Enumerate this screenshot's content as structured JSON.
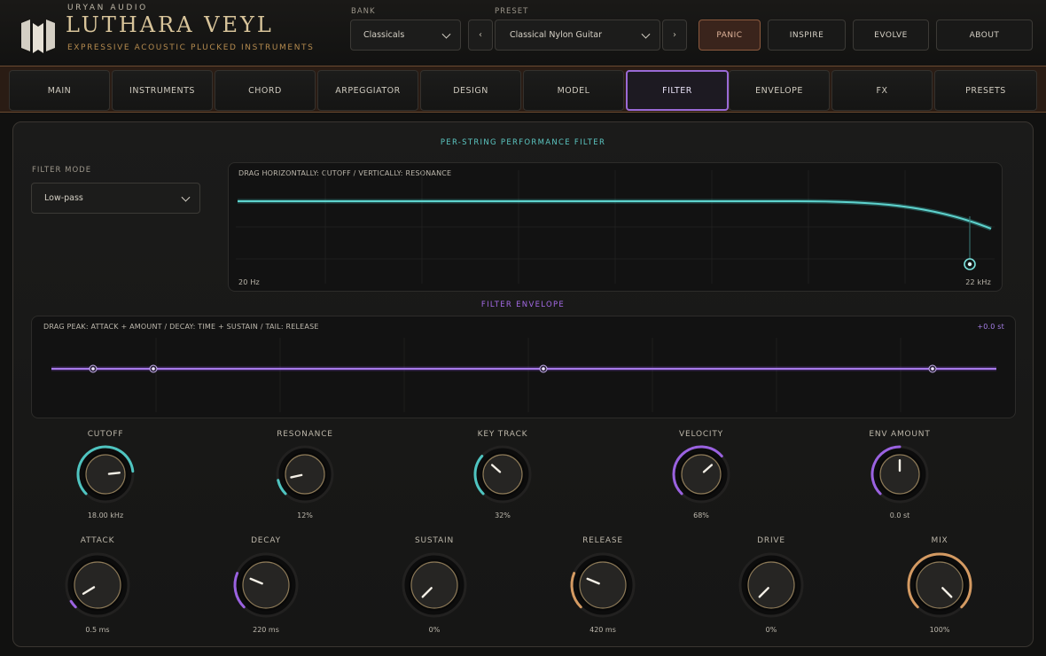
{
  "header": {
    "company": "URYAN AUDIO",
    "title": "LUTHARA VEYL",
    "subtitle": "EXPRESSIVE ACOUSTIC PLUCKED INSTRUMENTS",
    "bank_label": "BANK",
    "bank_value": "Classicals",
    "preset_label": "PRESET",
    "preset_value": "Classical Nylon Guitar",
    "prev_glyph": "‹",
    "next_glyph": "›",
    "buttons": {
      "panic": "PANIC",
      "inspire": "INSPIRE",
      "evolve": "EVOLVE",
      "about": "ABOUT"
    }
  },
  "tabs": [
    "MAIN",
    "INSTRUMENTS",
    "CHORD",
    "ARPEGGIATOR",
    "DESIGN",
    "MODEL",
    "FILTER",
    "ENVELOPE",
    "FX",
    "PRESETS"
  ],
  "active_tab": "FILTER",
  "filter": {
    "section_title": "PER-STRING PERFORMANCE FILTER",
    "mode_label": "FILTER MODE",
    "mode_value": "Low-pass",
    "graph_hint": "DRAG HORIZONTALLY: CUTOFF  /  VERTICALLY: RESONANCE",
    "freq_min": "20 Hz",
    "freq_max": "22 kHz"
  },
  "envelope": {
    "section_title": "FILTER ENVELOPE",
    "hint": "DRAG PEAK: ATTACK + AMOUNT  /  DECAY: TIME + SUSTAIN  /  TAIL: RELEASE",
    "amount_readout": "+0.0 st"
  },
  "knobs_row1": [
    {
      "label": "CUTOFF",
      "value": "18.00 kHz",
      "level": 0.81,
      "color": "#4fc4c0"
    },
    {
      "label": "RESONANCE",
      "value": "12%",
      "level": 0.12,
      "color": "#4fc4c0"
    },
    {
      "label": "KEY TRACK",
      "value": "32%",
      "level": 0.32,
      "color": "#4fc4c0"
    },
    {
      "label": "VELOCITY",
      "value": "68%",
      "level": 0.68,
      "color": "#9a62e0"
    },
    {
      "label": "ENV AMOUNT",
      "value": "0.0 st",
      "level": 0.5,
      "color": "#9a62e0"
    }
  ],
  "knobs_row2": [
    {
      "label": "ATTACK",
      "value": "0.5 ms",
      "level": 0.05,
      "color": "#9a62e0"
    },
    {
      "label": "DECAY",
      "value": "220 ms",
      "level": 0.25,
      "color": "#9a62e0"
    },
    {
      "label": "SUSTAIN",
      "value": "0%",
      "level": 0.0,
      "color": "#9a62e0"
    },
    {
      "label": "RELEASE",
      "value": "420 ms",
      "level": 0.25,
      "color": "#d49a62"
    },
    {
      "label": "DRIVE",
      "value": "0%",
      "level": 0.0,
      "color": "#d49a62"
    },
    {
      "label": "MIX",
      "value": "100%",
      "level": 1.0,
      "color": "#d49a62"
    }
  ]
}
